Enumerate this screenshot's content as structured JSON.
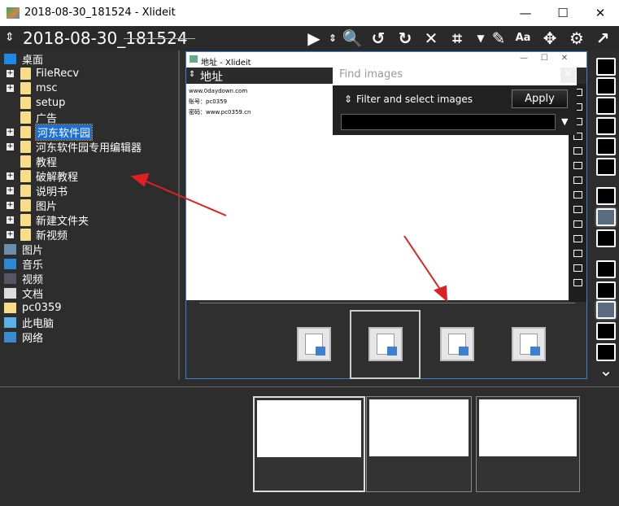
{
  "window": {
    "title": "2018-08-30_181524 - Xlideit",
    "minimize": "—",
    "maximize": "☐",
    "close": "✕"
  },
  "header": {
    "title": "2018-08-30_181524",
    "sort_icon": "updown-arrows-icon"
  },
  "toolbar": [
    {
      "name": "play",
      "glyph": "▶"
    },
    {
      "name": "sort",
      "glyph": "⇕"
    },
    {
      "name": "zoom",
      "glyph": "🔍"
    },
    {
      "name": "rotate-left",
      "glyph": "↺"
    },
    {
      "name": "rotate-right",
      "glyph": "↻"
    },
    {
      "name": "close",
      "glyph": "✕"
    },
    {
      "name": "crop",
      "glyph": "⌗"
    },
    {
      "name": "dropdown",
      "glyph": "▼"
    },
    {
      "name": "edit",
      "glyph": "✎"
    },
    {
      "name": "font",
      "glyph": "Aa"
    },
    {
      "name": "move",
      "glyph": "✥"
    },
    {
      "name": "settings",
      "glyph": "⚙"
    },
    {
      "name": "external",
      "glyph": "↗"
    }
  ],
  "tree": {
    "root": "桌面",
    "children": [
      {
        "label": "FileRecv",
        "expandable": true
      },
      {
        "label": "msc",
        "expandable": true
      },
      {
        "label": "setup",
        "expandable": false
      },
      {
        "label": "广告",
        "expandable": false
      },
      {
        "label": "河东软件园",
        "expandable": true,
        "selected": true
      },
      {
        "label": "河东软件园专用编辑器",
        "expandable": true
      },
      {
        "label": "教程",
        "expandable": false
      },
      {
        "label": "破解教程",
        "expandable": true
      },
      {
        "label": "说明书",
        "expandable": true
      },
      {
        "label": "图片",
        "expandable": true
      },
      {
        "label": "新建文件夹",
        "expandable": true
      },
      {
        "label": "新视频",
        "expandable": true
      }
    ],
    "top": [
      {
        "label": "图片",
        "icon": "pictures-icon",
        "color": "#6b8db0"
      },
      {
        "label": "音乐",
        "icon": "music-icon",
        "color": "#2a8ad8"
      },
      {
        "label": "视频",
        "icon": "video-icon",
        "color": "#556"
      },
      {
        "label": "文档",
        "icon": "document-icon",
        "color": "#ddd"
      },
      {
        "label": "pc0359",
        "icon": "folder-icon",
        "color": "#f7dc8a"
      },
      {
        "label": "此电脑",
        "icon": "computer-icon",
        "color": "#5ab0e8"
      },
      {
        "label": "网络",
        "icon": "network-icon",
        "color": "#3a8ad0"
      }
    ]
  },
  "preview": {
    "title": "地址 - Xlideit",
    "header": "地址",
    "lines": [
      "www.0daydown.com",
      "账号：pc0359",
      "密码：www.pc0359.cn"
    ]
  },
  "find": {
    "title": "Find images",
    "close": "×",
    "filter_label": "Filter and select images",
    "apply": "Apply",
    "value": ""
  },
  "right_tools": [
    "edit",
    "print",
    "printer",
    "image",
    "list",
    "folder-export",
    "zoom-frame",
    "folder",
    "camera",
    "folder-add",
    "clipboard-add",
    "search-frame",
    "checkbox",
    "exit",
    "chevron-down"
  ],
  "thumbnails": 4,
  "accent": "#3b82d6",
  "arrow_color": "#e02020"
}
